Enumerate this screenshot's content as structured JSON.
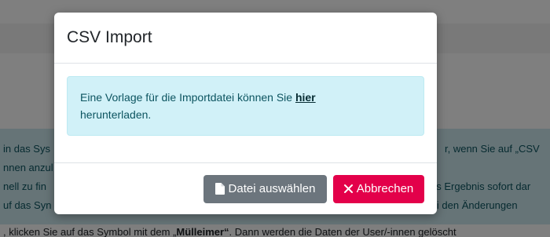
{
  "background": {
    "info_lines_left": [
      "in das Sys",
      "nnen anzul",
      "nell zu fin",
      "uf das Syn"
    ],
    "info_lines_right": [
      "r, wenn Sie auf „CSV",
      "as Ergebnis sofort dar",
      "Bei den Änderungen"
    ],
    "footer_line_start": ", klicken Sie auf das Symbol mit dem „",
    "footer_line_bold": "Mülleimer“",
    "footer_line_end": ". Dann werden die Daten der User/-innen gelöscht"
  },
  "modal": {
    "title": "CSV Import",
    "info_text_before": "Eine Vorlage für die Importdatei können Sie ",
    "info_link": "hier",
    "info_text_after": "herunterladen.",
    "select_file_button": "Datei auswählen",
    "cancel_button": "Abbrechen",
    "file_icon": "file-icon",
    "close_icon": "x-icon"
  },
  "colors": {
    "backdrop": "rgba(0,0,0,0.5)",
    "info_background": "#d1f1f8",
    "secondary_button": "#6c757d",
    "danger_button": "#e3004a"
  }
}
